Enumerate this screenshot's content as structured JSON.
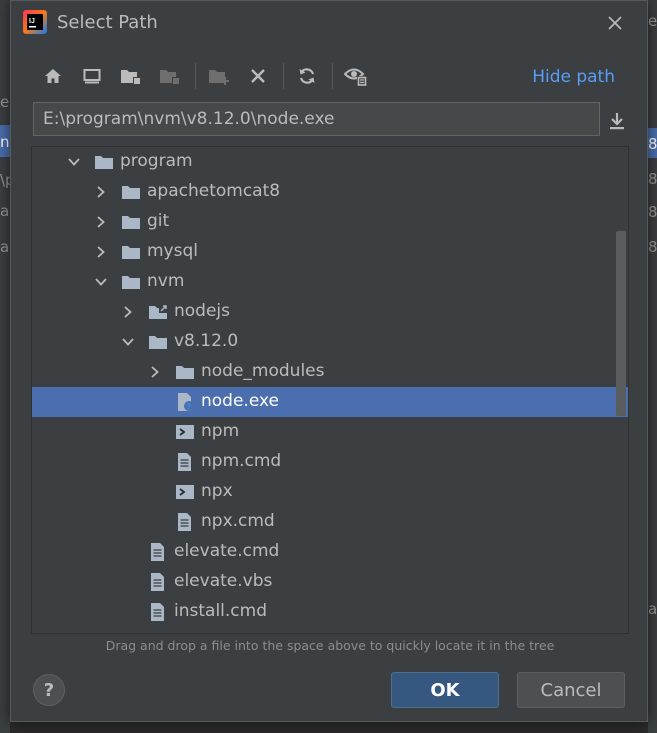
{
  "background": {
    "fragments": [
      "e",
      "n",
      "\\p",
      "a",
      "a",
      "8",
      "8",
      "8",
      "8",
      "e",
      "a"
    ]
  },
  "dialog": {
    "title": "Select Path",
    "icons": {
      "app_logo": "intellij-logo-icon",
      "close": "close-icon"
    },
    "toolbar": {
      "buttons": [
        {
          "name": "home-directory-button",
          "icon": "home-icon"
        },
        {
          "name": "desktop-directory-button",
          "icon": "desktop-icon"
        },
        {
          "name": "project-directory-button",
          "icon": "project-folder-icon"
        },
        {
          "name": "module-directory-button",
          "icon": "module-folder-icon"
        },
        {
          "name": "new-folder-button",
          "icon": "new-folder-icon"
        },
        {
          "name": "delete-button",
          "icon": "delete-icon"
        },
        {
          "name": "refresh-button",
          "icon": "refresh-icon"
        },
        {
          "name": "show-hidden-files-button",
          "icon": "show-hidden-icon"
        }
      ],
      "hide_path_label": "Hide path"
    },
    "path_field": {
      "value": "E:\\program\\nvm\\v8.12.0\\node.exe"
    },
    "tree": {
      "items": [
        {
          "label": "program",
          "expanded": true,
          "type": "folder"
        },
        {
          "label": "apachetomcat8",
          "expanded": false,
          "type": "folder"
        },
        {
          "label": "git",
          "expanded": false,
          "type": "folder"
        },
        {
          "label": "mysql",
          "expanded": false,
          "type": "folder"
        },
        {
          "label": "nvm",
          "expanded": true,
          "type": "folder"
        },
        {
          "label": "nodejs",
          "expanded": false,
          "type": "symlink-folder"
        },
        {
          "label": "v8.12.0",
          "expanded": true,
          "type": "folder"
        },
        {
          "label": "node_modules",
          "expanded": false,
          "type": "folder"
        },
        {
          "label": "node.exe",
          "type": "unknown-file",
          "selected": true
        },
        {
          "label": "npm",
          "type": "script-file"
        },
        {
          "label": "npm.cmd",
          "type": "text-file"
        },
        {
          "label": "npx",
          "type": "script-file"
        },
        {
          "label": "npx.cmd",
          "type": "text-file"
        },
        {
          "label": "elevate.cmd",
          "type": "text-file"
        },
        {
          "label": "elevate.vbs",
          "type": "text-file"
        },
        {
          "label": "install.cmd",
          "type": "text-file"
        }
      ]
    },
    "hint": "Drag and drop a file into the space above to quickly locate it in the tree",
    "buttons": {
      "help": "?",
      "ok": "OK",
      "cancel": "Cancel"
    },
    "colors": {
      "accent": "#589df6",
      "selection": "#4b6eaf",
      "ok_button": "#365880",
      "background": "#3c3f41"
    }
  }
}
